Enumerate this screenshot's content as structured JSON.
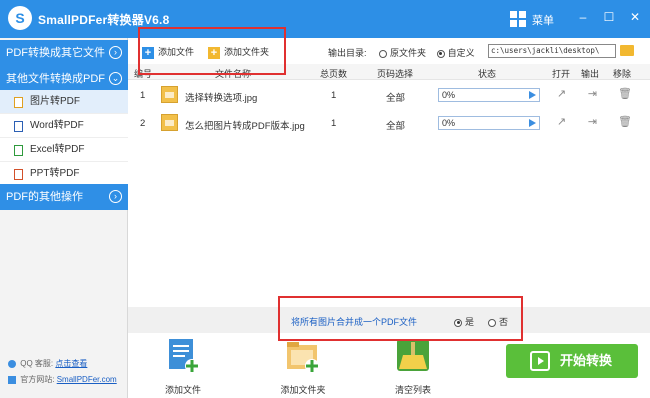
{
  "app": {
    "title": "SmallPDFer转换器V6.8",
    "logo_letter": "S",
    "menu_label": "菜单",
    "minimize_glyph": "–",
    "maximize_glyph": "☐",
    "close_glyph": "✕",
    "accent_color": "#2d8fe6"
  },
  "sidebar": {
    "sections": [
      {
        "label": "PDF转换成其它文件",
        "toggle_icon": "chevron-right-icon",
        "toggle_glyph": "›"
      },
      {
        "label": "其他文件转换成PDF",
        "toggle_icon": "chevron-down-icon",
        "toggle_glyph": "⌄"
      },
      {
        "label": "PDF的其他操作",
        "toggle_icon": "chevron-right-icon",
        "toggle_glyph": "›"
      }
    ],
    "items": [
      {
        "label": "图片转PDF",
        "icon": "image-file-icon",
        "active": true
      },
      {
        "label": "Word转PDF",
        "icon": "word-file-icon",
        "active": false
      },
      {
        "label": "Excel转PDF",
        "icon": "excel-file-icon",
        "active": false
      },
      {
        "label": "PPT转PDF",
        "icon": "ppt-file-icon",
        "active": false
      }
    ],
    "footer": {
      "qq_label": "QQ 客服:",
      "qq_link": "点击查看",
      "site_label": "官方网站:",
      "site_link": "SmallPDFer.com"
    }
  },
  "toolbar": {
    "add_file": "添加文件",
    "add_folder": "添加文件夹",
    "output_label": "输出目录:",
    "option_original": "原文件夹",
    "option_custom": "自定义",
    "selected_option": "自定义",
    "output_path": "c:\\users\\jackli\\desktop\\"
  },
  "table": {
    "headers": [
      "编号",
      "文件名称",
      "总页数",
      "页码选择",
      "状态",
      "打开",
      "输出",
      "移除"
    ],
    "rows": [
      {
        "index": "1",
        "name": "选择转换选项.jpg",
        "pages": "1",
        "range": "全部",
        "progress": "0%",
        "progress_fraction": 0
      },
      {
        "index": "2",
        "name": "怎么把图片转成PDF版本.jpg",
        "pages": "1",
        "range": "全部",
        "progress": "0%",
        "progress_fraction": 0
      }
    ]
  },
  "merge": {
    "text": "将所有图片合并成一个PDF文件",
    "yes": "是",
    "no": "否",
    "selected": "是"
  },
  "bottom": {
    "add_file": "添加文件",
    "add_folder": "添加文件夹",
    "clear_list": "清空列表",
    "start": "开始转换",
    "start_color": "#5abf3a"
  }
}
